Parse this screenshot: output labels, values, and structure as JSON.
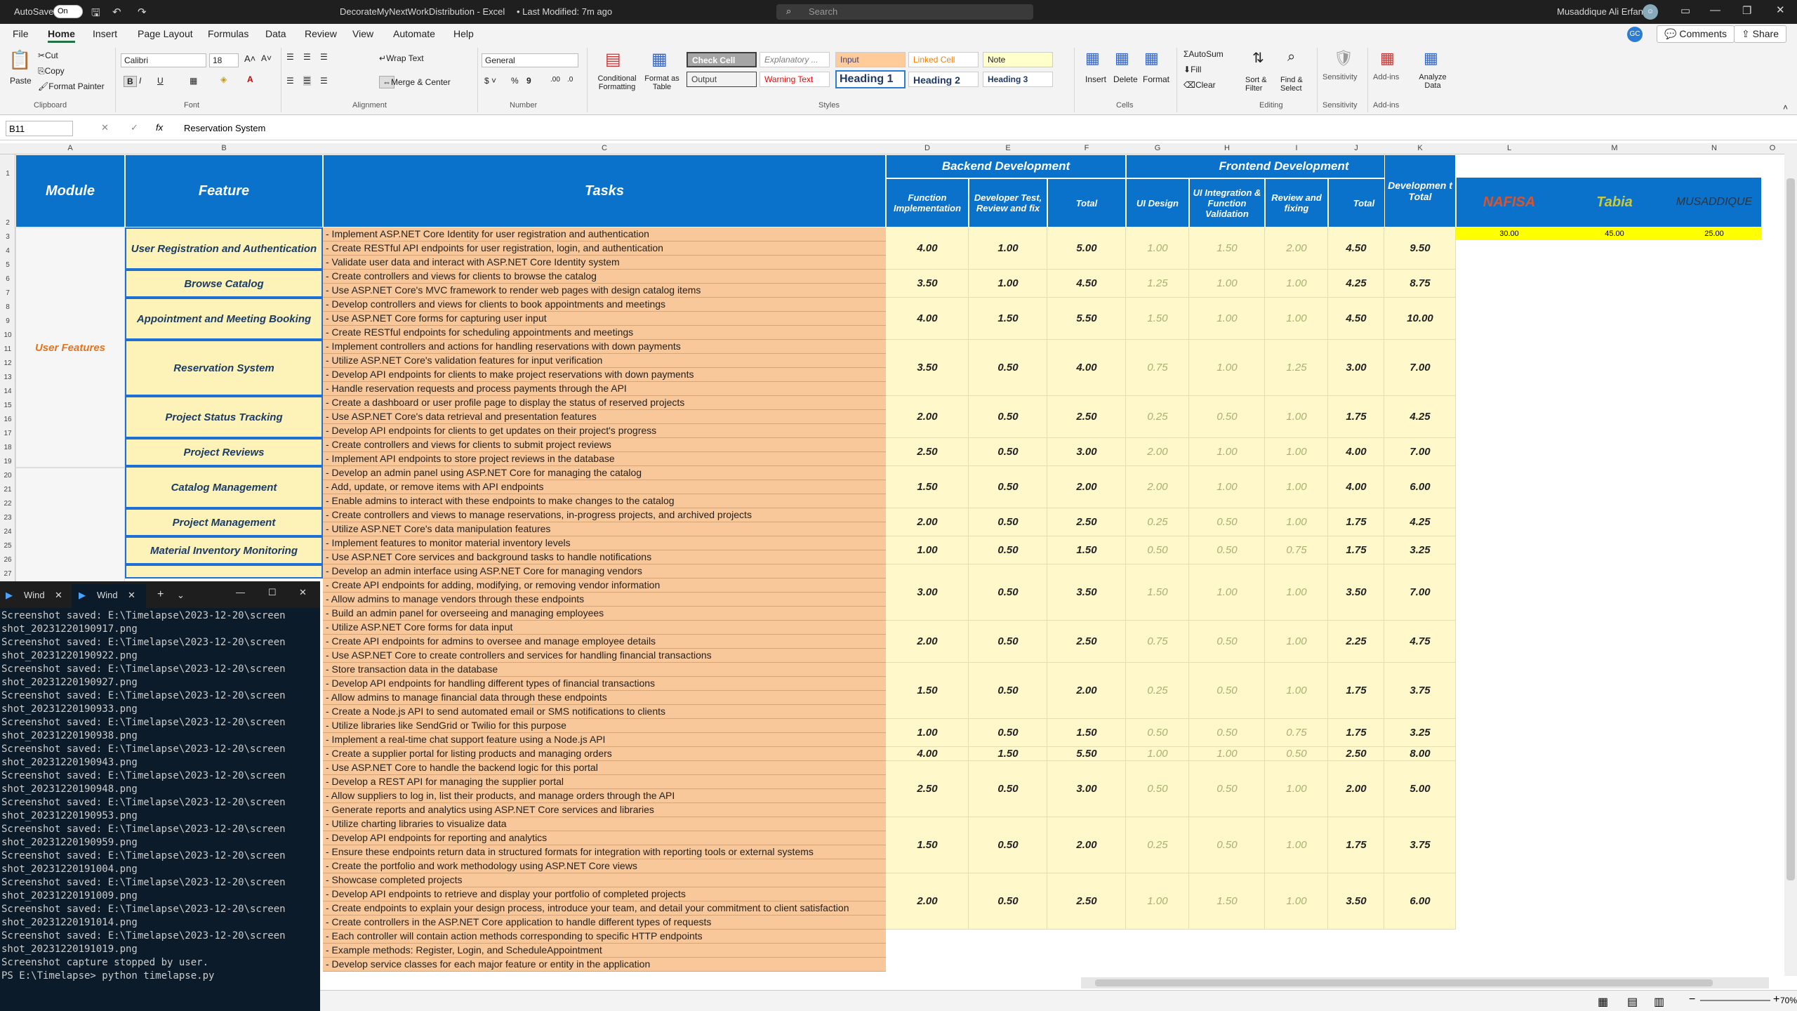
{
  "titlebar": {
    "autosave": "AutoSave",
    "toggle": "On",
    "filename": "DecorateMyNextWorkDistribution - Excel",
    "modified": "• Last Modified: 7m ago",
    "search": "Search",
    "user": "Musaddique Ali Erfan",
    "initials": "GC"
  },
  "menu": {
    "tabs": [
      "File",
      "Home",
      "Insert",
      "Page Layout",
      "Formulas",
      "Data",
      "Review",
      "View",
      "Automate",
      "Help"
    ],
    "comments": "Comments",
    "share": "Share"
  },
  "ribbon": {
    "paste": "Paste",
    "cut": "Cut",
    "copy": "Copy",
    "format_painter": "Format Painter",
    "clipboard": "Clipboard",
    "font_name": "Calibri",
    "font_size": "18",
    "font": "Font",
    "wrap": "Wrap Text",
    "merge": "Merge & Center",
    "alignment": "Alignment",
    "number_format": "General",
    "number": "Number",
    "cond": "Conditional Formatting",
    "fmt_table": "Format as Table",
    "styles": "Styles",
    "style_cells": [
      "Check Cell",
      "Explanatory ...",
      "Input",
      "Linked Cell",
      "Note",
      "Output",
      "Warning Text",
      "Heading 1",
      "Heading 2",
      "Heading 3"
    ],
    "insert": "Insert",
    "delete": "Delete",
    "format": "Format",
    "cells": "Cells",
    "autosum": "AutoSum",
    "fill": "Fill",
    "clear": "Clear",
    "sort": "Sort & Filter",
    "find": "Find & Select",
    "editing": "Editing",
    "sensitivity": "Sensitivity",
    "addins": "Add-ins",
    "analyze": "Analyze Data"
  },
  "formula": {
    "namebox": "B11",
    "fx": "fx",
    "value": "Reservation System"
  },
  "columns": [
    "A",
    "B",
    "C",
    "D",
    "E",
    "F",
    "G",
    "H",
    "I",
    "J",
    "K",
    "L",
    "M",
    "N",
    "O"
  ],
  "headers": {
    "module": "Module",
    "feature": "Feature",
    "tasks": "Tasks",
    "backend": "Backend Development",
    "frontend": "Frontend Development",
    "fi": "Function Implementation",
    "dtr": "Developer Test, Review and fix",
    "total": "Total",
    "ui": "UI Design",
    "uii": "UI Integration & Function Validation",
    "rf": "Review and fixing",
    "total2": "Total",
    "devtotal": "Developmen t Total"
  },
  "module_user": "User Features",
  "people": {
    "names": [
      "NAFISA",
      "Tabia",
      "MUSADDIQUE"
    ],
    "values": [
      "30.00",
      "45.00",
      "25.00"
    ]
  },
  "features": [
    "User Registration and Authentication",
    "Browse Catalog",
    "Appointment and Meeting Booking",
    "Reservation System",
    "Project Status Tracking",
    "Project Reviews",
    "Catalog Management",
    "Project Management",
    "Material Inventory Monitoring"
  ],
  "tasks": [
    "- Implement ASP.NET Core Identity for user registration and authentication",
    "- Create RESTful API endpoints for user registration, login, and authentication",
    "- Validate user data and interact with ASP.NET Core Identity system",
    "- Create controllers and views for clients to browse the catalog",
    "- Use ASP.NET Core's MVC framework to render web pages with design catalog items",
    "- Develop controllers and views for clients to book appointments and meetings",
    "- Use ASP.NET Core forms for capturing user input",
    "- Create RESTful endpoints for scheduling appointments and meetings",
    "- Implement controllers and actions for handling reservations with down payments",
    "- Utilize ASP.NET Core's validation features for input verification",
    "- Develop API endpoints for clients to make project reservations with down payments",
    "- Handle reservation requests and process payments through the API",
    "- Create a dashboard or user profile page to display the status of reserved projects",
    "- Use ASP.NET Core's data retrieval and presentation features",
    "- Develop API endpoints for clients to get updates on their project's progress",
    "- Create controllers and views for clients to submit project reviews",
    "- Implement API endpoints to store project reviews in the database",
    "- Develop an admin panel using ASP.NET Core for managing the catalog",
    "- Add, update, or remove items with API endpoints",
    "- Enable admins to interact with these endpoints to make changes to the catalog",
    "- Create controllers and views to manage reservations, in-progress projects, and archived projects",
    "- Utilize ASP.NET Core's data manipulation features",
    "- Implement features to monitor material inventory levels",
    "- Use ASP.NET Core services and background tasks to handle notifications",
    "- Develop an admin interface using ASP.NET Core for managing vendors",
    "- Create API endpoints for adding, modifying, or removing vendor information",
    "- Allow admins to manage vendors through these endpoints",
    "- Build an admin panel for overseeing and managing employees",
    "- Utilize ASP.NET Core forms for data input",
    "- Create API endpoints for admins to oversee and manage employee details",
    "- Use ASP.NET Core to create controllers and services for handling financial transactions",
    "- Store transaction data in the database",
    "- Develop API endpoints for handling different types of financial transactions",
    "- Allow admins to manage financial data through these endpoints",
    "- Create a Node.js API to send automated email or SMS notifications to clients",
    "- Utilize libraries like SendGrid or Twilio for this purpose",
    "- Implement a real-time chat support feature using a Node.js API",
    "- Create a supplier portal for listing products and managing orders",
    "- Use ASP.NET Core to handle the backend logic for this portal",
    "- Develop a REST API for managing the supplier portal",
    "- Allow suppliers to log in, list their products, and manage orders through the API",
    "- Generate reports and analytics using ASP.NET Core services and libraries",
    "- Utilize charting libraries to visualize data",
    "- Develop API endpoints for reporting and analytics",
    "- Ensure these endpoints return data in structured formats for integration with reporting tools or external systems",
    "- Create the portfolio and work methodology using ASP.NET Core views",
    "- Showcase completed projects",
    "- Develop API endpoints to retrieve and display your portfolio of completed projects",
    "- Create endpoints to explain your design process, introduce your team, and detail your commitment to client satisfaction",
    "- Create controllers in the ASP.NET Core application to handle different types of requests",
    "- Each controller will contain action methods corresponding to specific HTTP endpoints",
    "- Example methods: Register, Login, and ScheduleAppointment",
    "- Develop service classes for each major feature or entity in the application"
  ],
  "values": [
    [
      "4.00",
      "1.00",
      "5.00",
      "1.00",
      "1.50",
      "2.00",
      "4.50",
      "9.50"
    ],
    [
      "3.50",
      "1.00",
      "4.50",
      "1.25",
      "1.00",
      "1.00",
      "4.25",
      "8.75"
    ],
    [
      "4.00",
      "1.50",
      "5.50",
      "1.50",
      "1.00",
      "1.00",
      "4.50",
      "10.00"
    ],
    [
      "3.50",
      "0.50",
      "4.00",
      "0.75",
      "1.00",
      "1.25",
      "3.00",
      "7.00"
    ],
    [
      "2.00",
      "0.50",
      "2.50",
      "0.25",
      "0.50",
      "1.00",
      "1.75",
      "4.25"
    ],
    [
      "2.50",
      "0.50",
      "3.00",
      "2.00",
      "1.00",
      "1.00",
      "4.00",
      "7.00"
    ],
    [
      "1.50",
      "0.50",
      "2.00",
      "2.00",
      "1.00",
      "1.00",
      "4.00",
      "6.00"
    ],
    [
      "2.00",
      "0.50",
      "2.50",
      "0.25",
      "0.50",
      "1.00",
      "1.75",
      "4.25"
    ],
    [
      "1.00",
      "0.50",
      "1.50",
      "0.50",
      "0.50",
      "0.75",
      "1.75",
      "3.25"
    ],
    [
      "3.00",
      "0.50",
      "3.50",
      "1.50",
      "1.00",
      "1.00",
      "3.50",
      "7.00"
    ],
    [
      "2.00",
      "0.50",
      "2.50",
      "0.75",
      "0.50",
      "1.00",
      "2.25",
      "4.75"
    ],
    [
      "1.50",
      "0.50",
      "2.00",
      "0.25",
      "0.50",
      "1.00",
      "1.75",
      "3.75"
    ],
    [
      "1.00",
      "0.50",
      "1.50",
      "0.50",
      "0.50",
      "0.75",
      "1.75",
      "3.25"
    ],
    [
      "4.00",
      "1.50",
      "5.50",
      "1.00",
      "1.00",
      "0.50",
      "2.50",
      "8.00"
    ],
    [
      "2.50",
      "0.50",
      "3.00",
      "0.50",
      "0.50",
      "1.00",
      "2.00",
      "5.00"
    ],
    [
      "1.50",
      "0.50",
      "2.00",
      "0.25",
      "0.50",
      "1.00",
      "1.75",
      "3.75"
    ],
    [
      "2.00",
      "0.50",
      "2.50",
      "1.00",
      "1.50",
      "1.00",
      "3.50",
      "6.00"
    ]
  ],
  "terminal": {
    "tab1": "Wind",
    "tab2": "Wind",
    "lines": [
      "Screenshot saved: E:\\Timelapse\\2023-12-20\\screen",
      "shot_20231220190917.png",
      "Screenshot saved: E:\\Timelapse\\2023-12-20\\screen",
      "shot_20231220190922.png",
      "Screenshot saved: E:\\Timelapse\\2023-12-20\\screen",
      "shot_20231220190927.png",
      "Screenshot saved: E:\\Timelapse\\2023-12-20\\screen",
      "shot_20231220190933.png",
      "Screenshot saved: E:\\Timelapse\\2023-12-20\\screen",
      "shot_20231220190938.png",
      "Screenshot saved: E:\\Timelapse\\2023-12-20\\screen",
      "shot_20231220190943.png",
      "Screenshot saved: E:\\Timelapse\\2023-12-20\\screen",
      "shot_20231220190948.png",
      "Screenshot saved: E:\\Timelapse\\2023-12-20\\screen",
      "shot_20231220190953.png",
      "Screenshot saved: E:\\Timelapse\\2023-12-20\\screen",
      "shot_20231220190959.png",
      "Screenshot saved: E:\\Timelapse\\2023-12-20\\screen",
      "shot_20231220191004.png",
      "Screenshot saved: E:\\Timelapse\\2023-12-20\\screen",
      "shot_20231220191009.png",
      "Screenshot saved: E:\\Timelapse\\2023-12-20\\screen",
      "shot_20231220191014.png",
      "Screenshot saved: E:\\Timelapse\\2023-12-20\\screen",
      "shot_20231220191019.png",
      "",
      "Screenshot capture stopped by user.",
      "PS E:\\Timelapse> python timelapse.py"
    ]
  },
  "status": {
    "zoom": "70%"
  }
}
